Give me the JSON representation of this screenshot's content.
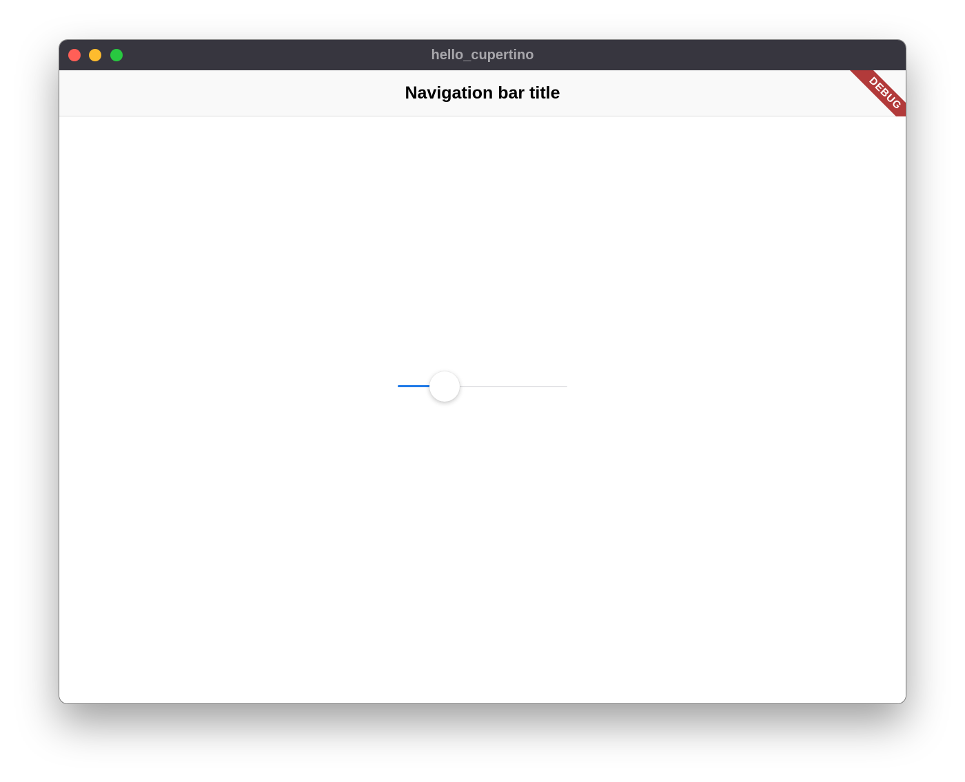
{
  "window": {
    "title": "hello_cupertino",
    "controls": {
      "close": "close-button",
      "minimize": "minimize-button",
      "zoom": "zoom-button"
    }
  },
  "navbar": {
    "title": "Navigation bar title"
  },
  "debug_banner": {
    "label": "DEBUG",
    "color": "#b23a3a"
  },
  "slider": {
    "value": 0.275,
    "min": 0,
    "max": 1,
    "active_color": "#1f7ae8",
    "track_color": "#e4e4e7"
  },
  "colors": {
    "titlebar": "#37363f",
    "navbar": "#f9f9f9",
    "close": "#ff5f57",
    "minimize": "#febc2e",
    "zoom": "#28c840"
  }
}
